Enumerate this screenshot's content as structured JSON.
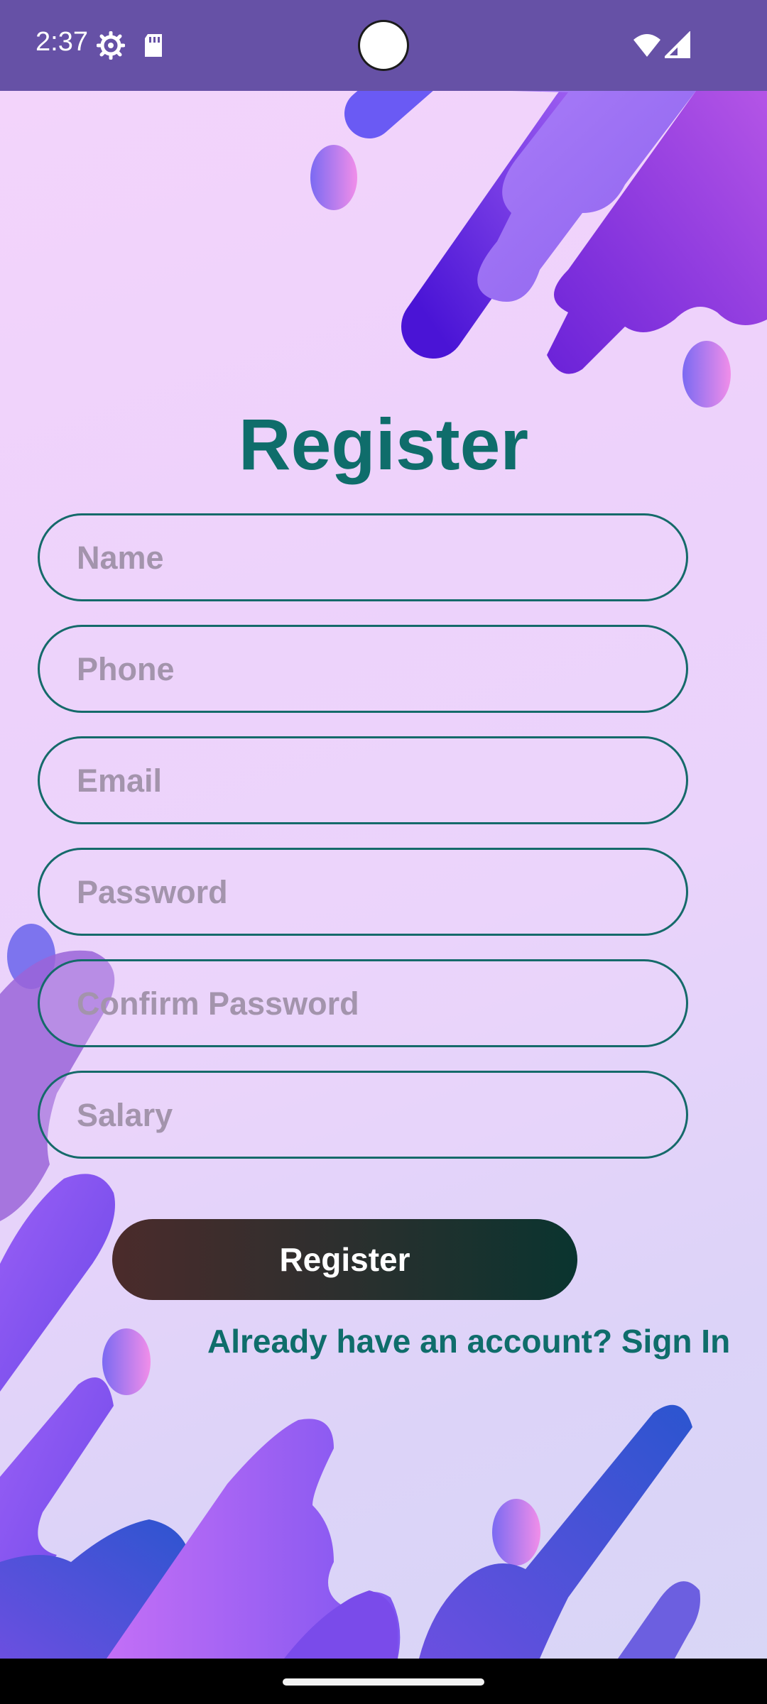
{
  "status_bar": {
    "time": "2:37",
    "icons": [
      "settings-gear-icon",
      "sd-card-icon",
      "wifi-icon",
      "cell-signal-icon"
    ],
    "background": "#6651a6"
  },
  "title": "Register",
  "form": {
    "name_placeholder": "Name",
    "phone_placeholder": "Phone",
    "email_placeholder": "Email",
    "password_placeholder": "Password",
    "confirm_password_placeholder": "Confirm Password",
    "salary_placeholder": "Salary"
  },
  "register_button": "Register",
  "sign_in_link": "Already have an account? Sign In",
  "colors": {
    "accent": "#0f6d6b",
    "field_border": "#156a6a",
    "button_start": "#4b2b2b",
    "button_end": "#0a342f"
  }
}
